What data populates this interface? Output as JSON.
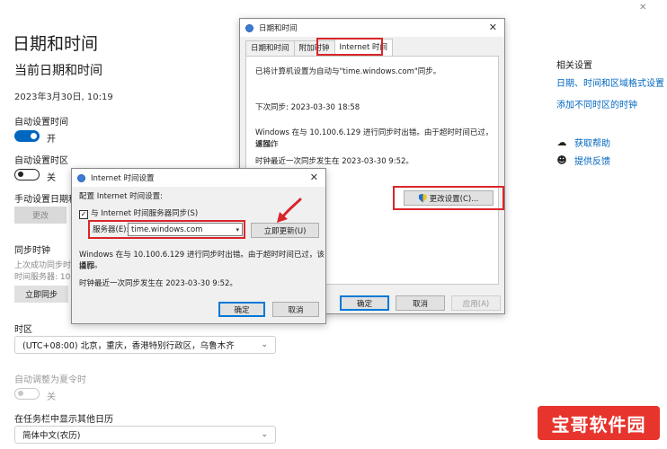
{
  "settings": {
    "title": "日期和时间",
    "current_heading": "当前日期和时间",
    "current_datetime": "2023年3月30日, 10:19",
    "auto_time_label": "自动设置时间",
    "auto_time_state": "开",
    "auto_zone_label": "自动设置时区",
    "auto_zone_state": "关",
    "manual_label": "手动设置日期和",
    "change_button": "更改",
    "sync_heading": "同步时钟",
    "last_sync_text": "上次成功同步时",
    "time_server_text": "时间服务器: 10.",
    "sync_now_button": "立即同步",
    "timezone_label": "时区",
    "timezone_value": "(UTC+08:00) 北京，重庆，香港特别行政区，乌鲁木齐",
    "dst_label": "自动调整为夏令时",
    "dst_state": "关",
    "calendar_label": "在任务栏中显示其他日历",
    "calendar_value": "简体中文(农历)"
  },
  "related": {
    "heading": "相关设置",
    "link1": "日期、时间和区域格式设置",
    "link2": "添加不同时区的时钟",
    "help": "获取帮助",
    "feedback": "提供反馈"
  },
  "dialog_main": {
    "title": "日期和时间",
    "tabs": [
      "日期和时间",
      "附加时钟",
      "Internet 时间"
    ],
    "line1": "已将计算机设置为自动与\"time.windows.com\"同步。",
    "next_sync": "下次同步: 2023-03-30 18:58",
    "error_line1": "Windows 在与 10.100.6.129 进行同步时出错。由于超时时间已过，该操作",
    "error_line2": "返回。",
    "last_sync": "时钟最近一次同步发生在 2023-03-30 9:52。",
    "change_settings_button": "更改设置(C)...",
    "ok": "确定",
    "cancel": "取消",
    "apply": "应用(A)"
  },
  "dialog_inet": {
    "title": "Internet 时间设置",
    "config_label": "配置 Internet 时间设置:",
    "sync_checkbox_label": "与 Internet 时间服务器同步(S)",
    "server_label": "服务器(E):",
    "server_value": "time.windows.com",
    "update_now_button": "立即更新(U)",
    "error_line1": "Windows 在与 10.100.6.129 进行同步时出错。由于超时时间已过，该操作",
    "error_line2": "返回。",
    "last_sync": "时钟最近一次同步发生在 2023-03-30 9:52。",
    "ok": "确定",
    "cancel": "取消"
  },
  "watermark": "宝哥软件园",
  "colors": {
    "accent": "#0067c0",
    "highlight": "#d9262b",
    "watermark_bg": "#e7342d"
  }
}
